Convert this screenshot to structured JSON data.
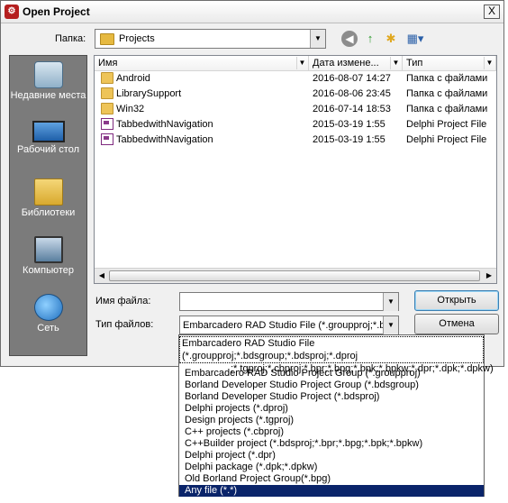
{
  "window": {
    "title": "Open Project",
    "app_icon": "delphi-app-icon",
    "close_label": "X"
  },
  "toolbar": {
    "look_in_label": "Папка:",
    "look_in_value": "Projects",
    "back_icon": "back-arrow-icon",
    "up_icon": "up-folder-icon",
    "new_folder_icon": "new-folder-icon",
    "view_icon": "view-menu-icon"
  },
  "places": [
    {
      "label": "Недавние места",
      "icon": "recent-places-icon"
    },
    {
      "label": "Рабочий стол",
      "icon": "desktop-icon"
    },
    {
      "label": "Библиотеки",
      "icon": "libraries-icon"
    },
    {
      "label": "Компьютер",
      "icon": "computer-icon"
    },
    {
      "label": "Сеть",
      "icon": "network-icon"
    }
  ],
  "list": {
    "headers": {
      "name": "Имя",
      "date": "Дата измене...",
      "type": "Тип"
    },
    "rows": [
      {
        "name": "Android",
        "date": "2016-08-07 14:27",
        "type": "Папка с файлами",
        "icon": "folder-icon"
      },
      {
        "name": "LibrarySupport",
        "date": "2016-08-06 23:45",
        "type": "Папка с файлами",
        "icon": "folder-icon"
      },
      {
        "name": "Win32",
        "date": "2016-07-14 18:53",
        "type": "Папка с файлами",
        "icon": "folder-icon"
      },
      {
        "name": "TabbedwithNavigation",
        "date": "2015-03-19 1:55",
        "type": "Delphi Project File",
        "icon": "dpr-file-icon"
      },
      {
        "name": "TabbedwithNavigation",
        "date": "2015-03-19 1:55",
        "type": "Delphi Project File",
        "icon": "dpr-file-icon"
      }
    ]
  },
  "filename": {
    "label": "Имя файла:",
    "value": ""
  },
  "filetype": {
    "label": "Тип файлов:",
    "value": "Embarcadero RAD Studio File (*.groupproj;*.bds"
  },
  "buttons": {
    "open": "Открыть",
    "cancel": "Отмена"
  },
  "filetype_options": {
    "first_line1": "Embarcadero RAD Studio File (*.groupproj;*.bdsgroup;*.bdsproj;*.dproj",
    "first_line2": ";*.tgproj;*.cbproj;*.bpr;*.bpg;*.bpk;*.bpkw;*.dpr;*.dpk;*.dpkw)",
    "items": [
      "Embarcadero RAD Studio Project Group (*.groupproj)",
      "Borland Developer Studio Project Group (*.bdsgroup)",
      "Borland Developer Studio Project (*.bdsproj)",
      "Delphi projects (*.dproj)",
      "Design projects (*.tgproj)",
      "C++ projects (*.cbproj)",
      "C++Builder project (*.bdsproj;*.bpr;*.bpg;*.bpk;*.bpkw)",
      "Delphi project (*.dpr)",
      "Delphi package (*.dpk;*.dpkw)",
      "Old Borland Project Group(*.bpg)",
      "Any file (*.*)"
    ],
    "selected_index": 10
  }
}
